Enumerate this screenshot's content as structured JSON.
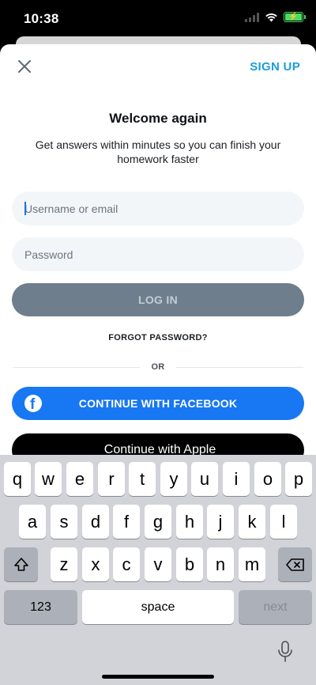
{
  "status_bar": {
    "time": "10:38",
    "battery_bolt": "⚡"
  },
  "header": {
    "signup_label": "SIGN UP",
    "close_icon": "close-icon"
  },
  "login": {
    "title": "Welcome again",
    "subtitle": "Get answers within minutes so you can finish your homework faster",
    "username_placeholder": "Username or email",
    "username_value": "",
    "password_placeholder": "Password",
    "password_value": "",
    "login_label": "LOG IN",
    "forgot_label": "FORGOT PASSWORD?",
    "or_label": "OR",
    "facebook_label": "CONTINUE WITH FACEBOOK",
    "facebook_glyph": "f",
    "apple_label": "Continue with Apple",
    "apple_glyph": ""
  },
  "keyboard": {
    "row1": [
      "q",
      "w",
      "e",
      "r",
      "t",
      "y",
      "u",
      "i",
      "o",
      "p"
    ],
    "row2": [
      "a",
      "s",
      "d",
      "f",
      "g",
      "h",
      "j",
      "k",
      "l"
    ],
    "row3": [
      "z",
      "x",
      "c",
      "v",
      "b",
      "n",
      "m"
    ],
    "numbers_label": "123",
    "space_label": "space",
    "next_label": "next"
  },
  "colors": {
    "accent": "#1a9de0",
    "facebook": "#1877f2",
    "login_disabled": "#6f7e8c",
    "field_bg": "#f3f6f9"
  }
}
